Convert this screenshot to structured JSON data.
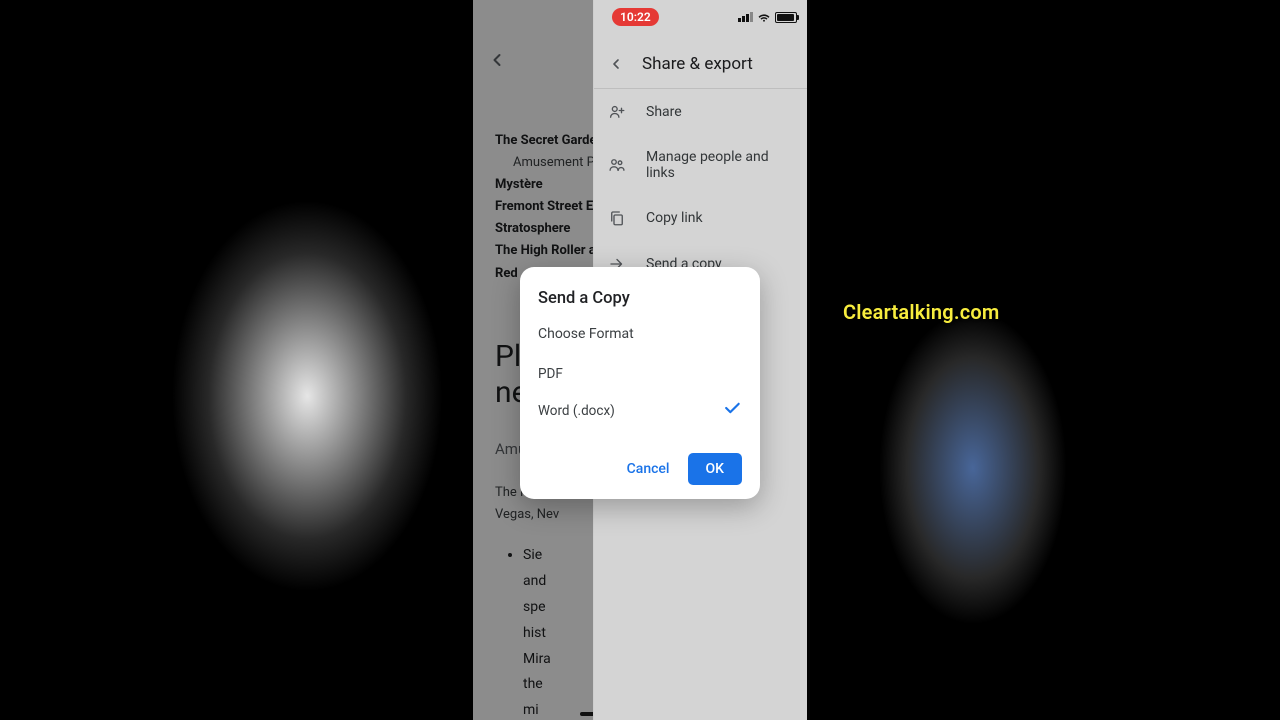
{
  "status": {
    "time": "10:22"
  },
  "doc": {
    "items": [
      {
        "title": "The Secret Garde",
        "sub": "Amusement Pa"
      },
      {
        "title": "Mystère"
      },
      {
        "title": "Fremont Street Ex"
      },
      {
        "title": "Stratosphere"
      },
      {
        "title": "The High Roller a"
      },
      {
        "title": "Red"
      }
    ],
    "heading_l1": "Pl",
    "heading_l2": "ne",
    "section_sub": "Amusem",
    "address_l1": "The Mirage",
    "address_l2": "Vegas, Nev",
    "bullets": [
      "Sie",
      "and",
      "spe",
      "hist",
      "Mira",
      "the",
      "mi"
    ]
  },
  "panel": {
    "title": "Share & export",
    "items": [
      {
        "icon": "person-add",
        "label": "Share"
      },
      {
        "icon": "people",
        "label": "Manage people and links"
      },
      {
        "icon": "copy",
        "label": "Copy link"
      },
      {
        "icon": "send",
        "label": "Send a copy"
      }
    ]
  },
  "modal": {
    "title": "Send a Copy",
    "subtitle": "Choose Format",
    "options": [
      {
        "label": "PDF",
        "selected": false
      },
      {
        "label": "Word (.docx)",
        "selected": true
      }
    ],
    "cancel": "Cancel",
    "ok": "OK"
  },
  "watermark": "Cleartalking.com"
}
